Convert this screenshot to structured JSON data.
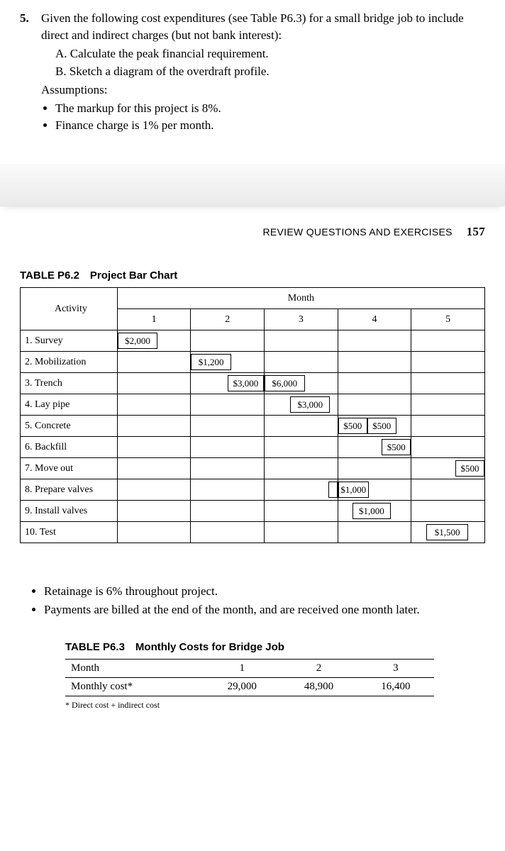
{
  "problem": {
    "number": "5.",
    "intro": "Given the following cost expenditures (see Table P6.3) for a small bridge job to include direct and indirect charges (but not bank interest):",
    "parts": [
      "A. Calculate the peak financial requirement.",
      "B. Sketch a diagram of the overdraft profile."
    ],
    "assumptions_label": "Assumptions:",
    "assumptions": [
      "The markup for this project is 8%.",
      "Finance charge is 1% per month."
    ]
  },
  "runhead": {
    "text": "REVIEW QUESTIONS AND EXERCISES",
    "page": "157"
  },
  "barchart": {
    "title": "TABLE P6.2 Project Bar Chart",
    "activity_header": "Activity",
    "month_header": "Month",
    "months": [
      "1",
      "2",
      "3",
      "4",
      "5"
    ],
    "rows": [
      {
        "activity": "1. Survey",
        "bars": [
          {
            "month": 1,
            "start": 0,
            "end": 55,
            "label": "$2,000"
          }
        ]
      },
      {
        "activity": "2. Mobilization",
        "bars": [
          {
            "month": 2,
            "start": 0,
            "end": 55,
            "label": "$1,200"
          }
        ]
      },
      {
        "activity": "3. Trench",
        "bars": [
          {
            "month": 2,
            "start": 50,
            "end": 100,
            "label": "$3,000"
          },
          {
            "month": 3,
            "start": 0,
            "end": 55,
            "label": "$6,000"
          }
        ]
      },
      {
        "activity": "4. Lay pipe",
        "bars": [
          {
            "month": 3,
            "start": 35,
            "end": 90,
            "label": "$3,000"
          }
        ]
      },
      {
        "activity": "5. Concrete",
        "bars": [
          {
            "month": 4,
            "start": 0,
            "end": 40,
            "label": "$500"
          },
          {
            "month": 4,
            "start": 40,
            "end": 80,
            "label": "$500"
          }
        ]
      },
      {
        "activity": "6. Backfill",
        "bars": [
          {
            "month": 4,
            "start": 60,
            "end": 100,
            "label": "$500"
          }
        ]
      },
      {
        "activity": "7. Move out",
        "bars": [
          {
            "month": 5,
            "start": 60,
            "end": 100,
            "label": "$500"
          }
        ]
      },
      {
        "activity": "8. Prepare valves",
        "bars": [
          {
            "month": 3,
            "start": 88,
            "end": 100,
            "label": ""
          },
          {
            "month": 4,
            "start": 0,
            "end": 42,
            "label": "$1,000"
          }
        ]
      },
      {
        "activity": "9. Install valves",
        "bars": [
          {
            "month": 4,
            "start": 20,
            "end": 72,
            "label": "$1,000"
          }
        ]
      },
      {
        "activity": "10. Test",
        "bars": [
          {
            "month": 5,
            "start": 20,
            "end": 78,
            "label": "$1,500"
          }
        ]
      }
    ]
  },
  "notes": [
    "Retainage is 6% throughout project.",
    "Payments are billed at the end of the month, and are received one month later."
  ],
  "table63": {
    "title": "TABLE P6.3 Monthly Costs for Bridge Job",
    "row_labels": [
      "Month",
      "Monthly cost*"
    ],
    "months": [
      "1",
      "2",
      "3"
    ],
    "costs": [
      "29,000",
      "48,900",
      "16,400"
    ],
    "footnote": "* Direct cost + indirect cost"
  },
  "chart_data": {
    "type": "table",
    "title": "Project Bar Chart (Gantt)",
    "series": [
      {
        "name": "1. Survey",
        "values": [
          2000,
          0,
          0,
          0,
          0
        ]
      },
      {
        "name": "2. Mobilization",
        "values": [
          0,
          1200,
          0,
          0,
          0
        ]
      },
      {
        "name": "3. Trench",
        "values": [
          0,
          3000,
          6000,
          0,
          0
        ]
      },
      {
        "name": "4. Lay pipe",
        "values": [
          0,
          0,
          3000,
          0,
          0
        ]
      },
      {
        "name": "5. Concrete",
        "values": [
          0,
          0,
          0,
          1000,
          0
        ]
      },
      {
        "name": "6. Backfill",
        "values": [
          0,
          0,
          0,
          500,
          0
        ]
      },
      {
        "name": "7. Move out",
        "values": [
          0,
          0,
          0,
          0,
          500
        ]
      },
      {
        "name": "8. Prepare valves",
        "values": [
          0,
          0,
          0,
          1000,
          0
        ]
      },
      {
        "name": "9. Install valves",
        "values": [
          0,
          0,
          0,
          1000,
          0
        ]
      },
      {
        "name": "10. Test",
        "values": [
          0,
          0,
          0,
          0,
          1500
        ]
      }
    ],
    "categories": [
      "1",
      "2",
      "3",
      "4",
      "5"
    ],
    "xlabel": "Month",
    "ylabel": "Activity"
  }
}
